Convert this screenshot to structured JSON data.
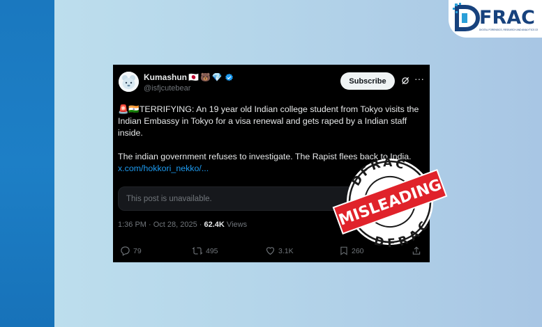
{
  "logo": {
    "text": "FRAC",
    "subtitle": "DIGITAL FORENSICS, RESEARCH AND ANALYTICS CENTRE"
  },
  "tweet": {
    "display_name": "Kumashun",
    "name_emojis": [
      "🇯🇵",
      "🐻",
      "💎"
    ],
    "handle": "@isfjcutebear",
    "subscribe_label": "Subscribe",
    "more_label": "···",
    "siren_emojis": "🚨🇮🇳",
    "paragraph1": "TERRIFYING: An 19 year old Indian college student from Tokyo visits the Indian Embassy in Tokyo for a visa renewal and gets raped by a Indian staff inside.",
    "paragraph2": "The indian government refuses to investigate. The Rapist flees back to India.",
    "link_text": "x.com/hokkori_nekko/...",
    "unavailable_text": "This post is unavailable.",
    "timestamp": "1:36 PM · Oct 28, 2025 · ",
    "views_count": "62.4K",
    "views_label": " Views",
    "actions": {
      "replies": "79",
      "reposts": "495",
      "likes": "3.1K",
      "bookmarks": "260"
    }
  },
  "stamp": {
    "top_text": "DFRAC",
    "bottom_text": "DFRAC",
    "label": "MISLEADING",
    "color": "#e0222a"
  },
  "colors": {
    "accent": "#1d9bf0",
    "verified": "#1d9bf0",
    "logo_blue": "#17427d"
  }
}
